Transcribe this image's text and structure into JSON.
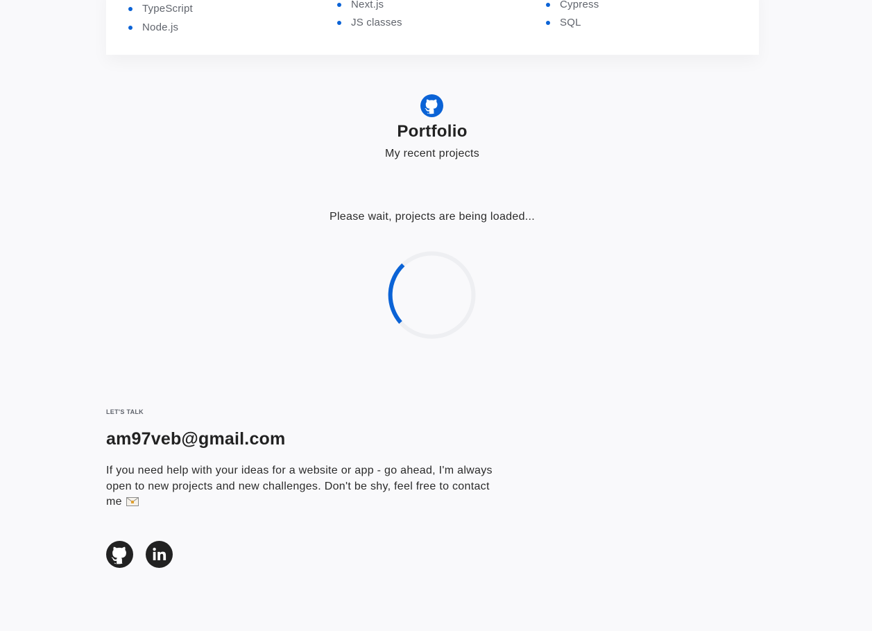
{
  "skills": {
    "column1": [
      "TypeScript",
      "Node.js"
    ],
    "column2": [
      "Next.js",
      "JS classes"
    ],
    "column3": [
      "Cypress",
      "SQL"
    ]
  },
  "portfolio": {
    "icon": "github-icon",
    "title": "Portfolio",
    "subtitle": "My recent projects",
    "loading_text": "Please wait, projects are being loaded..."
  },
  "contact": {
    "eyebrow": "LET'S TALK",
    "email": "am97veb@gmail.com",
    "text": "If you need help with your ideas for a website or app - go ahead, I'm always open to new projects and new challenges. Don't be shy, feel free to contact me"
  },
  "social": {
    "github_icon": "github-icon",
    "linkedin_icon": "linkedin-icon"
  },
  "colors": {
    "accent": "#0b63d6",
    "background": "#f9f9fb",
    "card": "#ffffff",
    "text": "#222222",
    "muted": "#60646c"
  }
}
